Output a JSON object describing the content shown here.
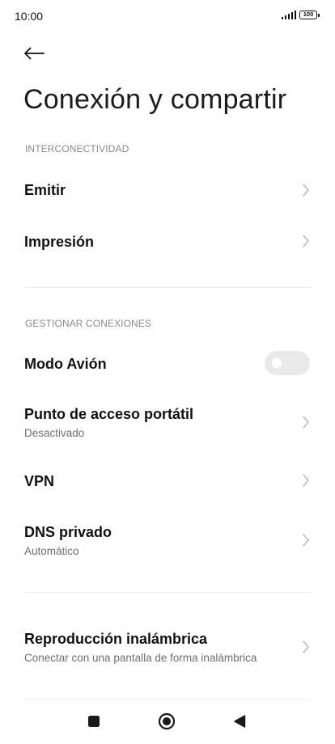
{
  "status_bar": {
    "time": "10:00",
    "battery": "100",
    "icons": [
      "signal-icon",
      "battery-icon"
    ]
  },
  "header": {
    "back_icon": "arrow-left-icon",
    "title": "Conexión y compartir"
  },
  "sections": [
    {
      "header": "INTERCONECTIVIDAD",
      "items": [
        {
          "title": "Emitir",
          "subtitle": "",
          "control": "chevron"
        },
        {
          "title": "Impresión",
          "subtitle": "",
          "control": "chevron"
        }
      ]
    },
    {
      "header": "GESTIONAR CONEXIONES",
      "items": [
        {
          "title": "Modo Avión",
          "subtitle": "",
          "control": "toggle",
          "toggle_on": false
        },
        {
          "title": "Punto de acceso portátil",
          "subtitle": "Desactivado",
          "control": "chevron"
        },
        {
          "title": "VPN",
          "subtitle": "",
          "control": "chevron"
        },
        {
          "title": "DNS privado",
          "subtitle": "Automático",
          "control": "chevron"
        }
      ]
    },
    {
      "header": "",
      "items": [
        {
          "title": "Reproducción inalámbrica",
          "subtitle": "Conectar con una pantalla de forma inalámbrica",
          "control": "chevron"
        }
      ]
    }
  ],
  "nav_bar": {
    "icons": [
      "recents-square-icon",
      "home-circle-icon",
      "back-triangle-icon"
    ]
  },
  "colors": {
    "background": "#ffffff",
    "text_primary": "#111111",
    "text_secondary": "#6e6e6e",
    "section_header": "#8a8a8a",
    "divider": "#ececec",
    "toggle_off": "#e9e9e9"
  }
}
